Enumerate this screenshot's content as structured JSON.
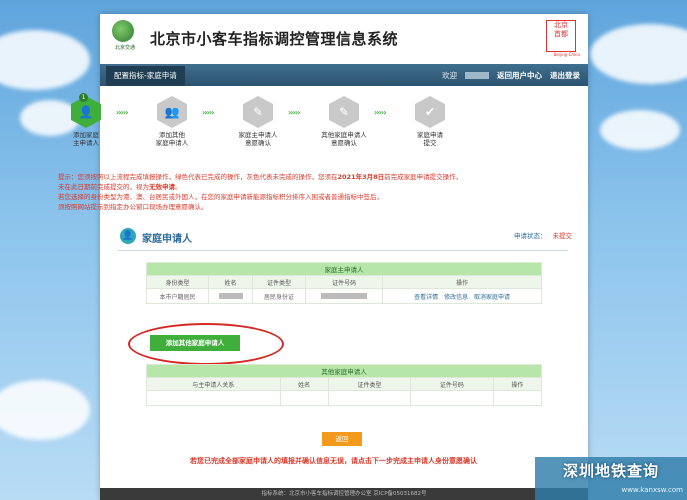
{
  "header": {
    "logo_text": "北京交通",
    "title": "北京市小客车指标调控管理信息系统",
    "seal_text": "北京\n首都",
    "seal_sub": "Beijing·China"
  },
  "nav": {
    "tab": "配置指标-家庭申请",
    "welcome": "欢迎",
    "user_center": "返回用户中心",
    "logout": "退出登录"
  },
  "steps": [
    {
      "num": "1",
      "label": "添加家庭\n主申请人",
      "icon": "add-person-icon",
      "active": true
    },
    {
      "label": "添加其他\n家庭申请人",
      "icon": "add-group-icon",
      "active": false
    },
    {
      "label": "家庭主申请人\n意愿确认",
      "icon": "confirm-person-icon",
      "active": false
    },
    {
      "label": "其他家庭申请人\n意愿确认",
      "icon": "confirm-group-icon",
      "active": false
    },
    {
      "label": "家庭申请\n提交",
      "icon": "check-icon",
      "active": false
    }
  ],
  "arrows": "›››››",
  "notice": {
    "prefix": "提示：您须按照以上流程完成填报操作，绿色代表已完成的操作，灰色代表未完成的操作，您须在",
    "date": "2021年3月8日",
    "mid": "前完成家庭申请提交操作，未在此日期前完成提交的，视为",
    "void": "无效申请",
    "line2": "若您选择的身份类型为港、澳、台居民或外国人，在您的家庭申请新能源指标积分排序入围或者普通指标中签后，",
    "line3": "须按照网站提示到指定办公窗口现场办理意愿确认。"
  },
  "section": {
    "title": "家庭申请人",
    "status_label": "申请状态：",
    "status_value": "未提交"
  },
  "main_table": {
    "title": "家庭主申请人",
    "columns": [
      "身份类型",
      "姓名",
      "证件类型",
      "证件号码",
      "操作"
    ],
    "row": {
      "identity": "本市户籍居民",
      "id_type": "居民身份证",
      "actions": [
        "查看详情",
        "修改信息",
        "取消家庭申请"
      ]
    }
  },
  "add_button": "添加其他家庭申请人",
  "other_table": {
    "title": "其他家庭申请人",
    "columns": [
      "与主申请人关系",
      "姓名",
      "证件类型",
      "证件号码",
      "操作"
    ]
  },
  "next_button": "返回",
  "bottom_note": "若您已完成全部家庭申请人的填报并确认信息无误，请点击下一步完成主申请人身份意愿确认",
  "footer": "指标系统：北京市小客车指标调控管理办公室 京ICP备05031682号",
  "watermark": {
    "main": "深圳地铁查询",
    "url": "www.kanxsw.com"
  },
  "colors": {
    "active_green": "#3fae3a",
    "inactive_gray": "#c9c9c9",
    "nav_blue": "#2c536e",
    "alert_red": "#d93a2b",
    "table_header_green": "#b7e7a8",
    "next_orange": "#f39a1c"
  }
}
